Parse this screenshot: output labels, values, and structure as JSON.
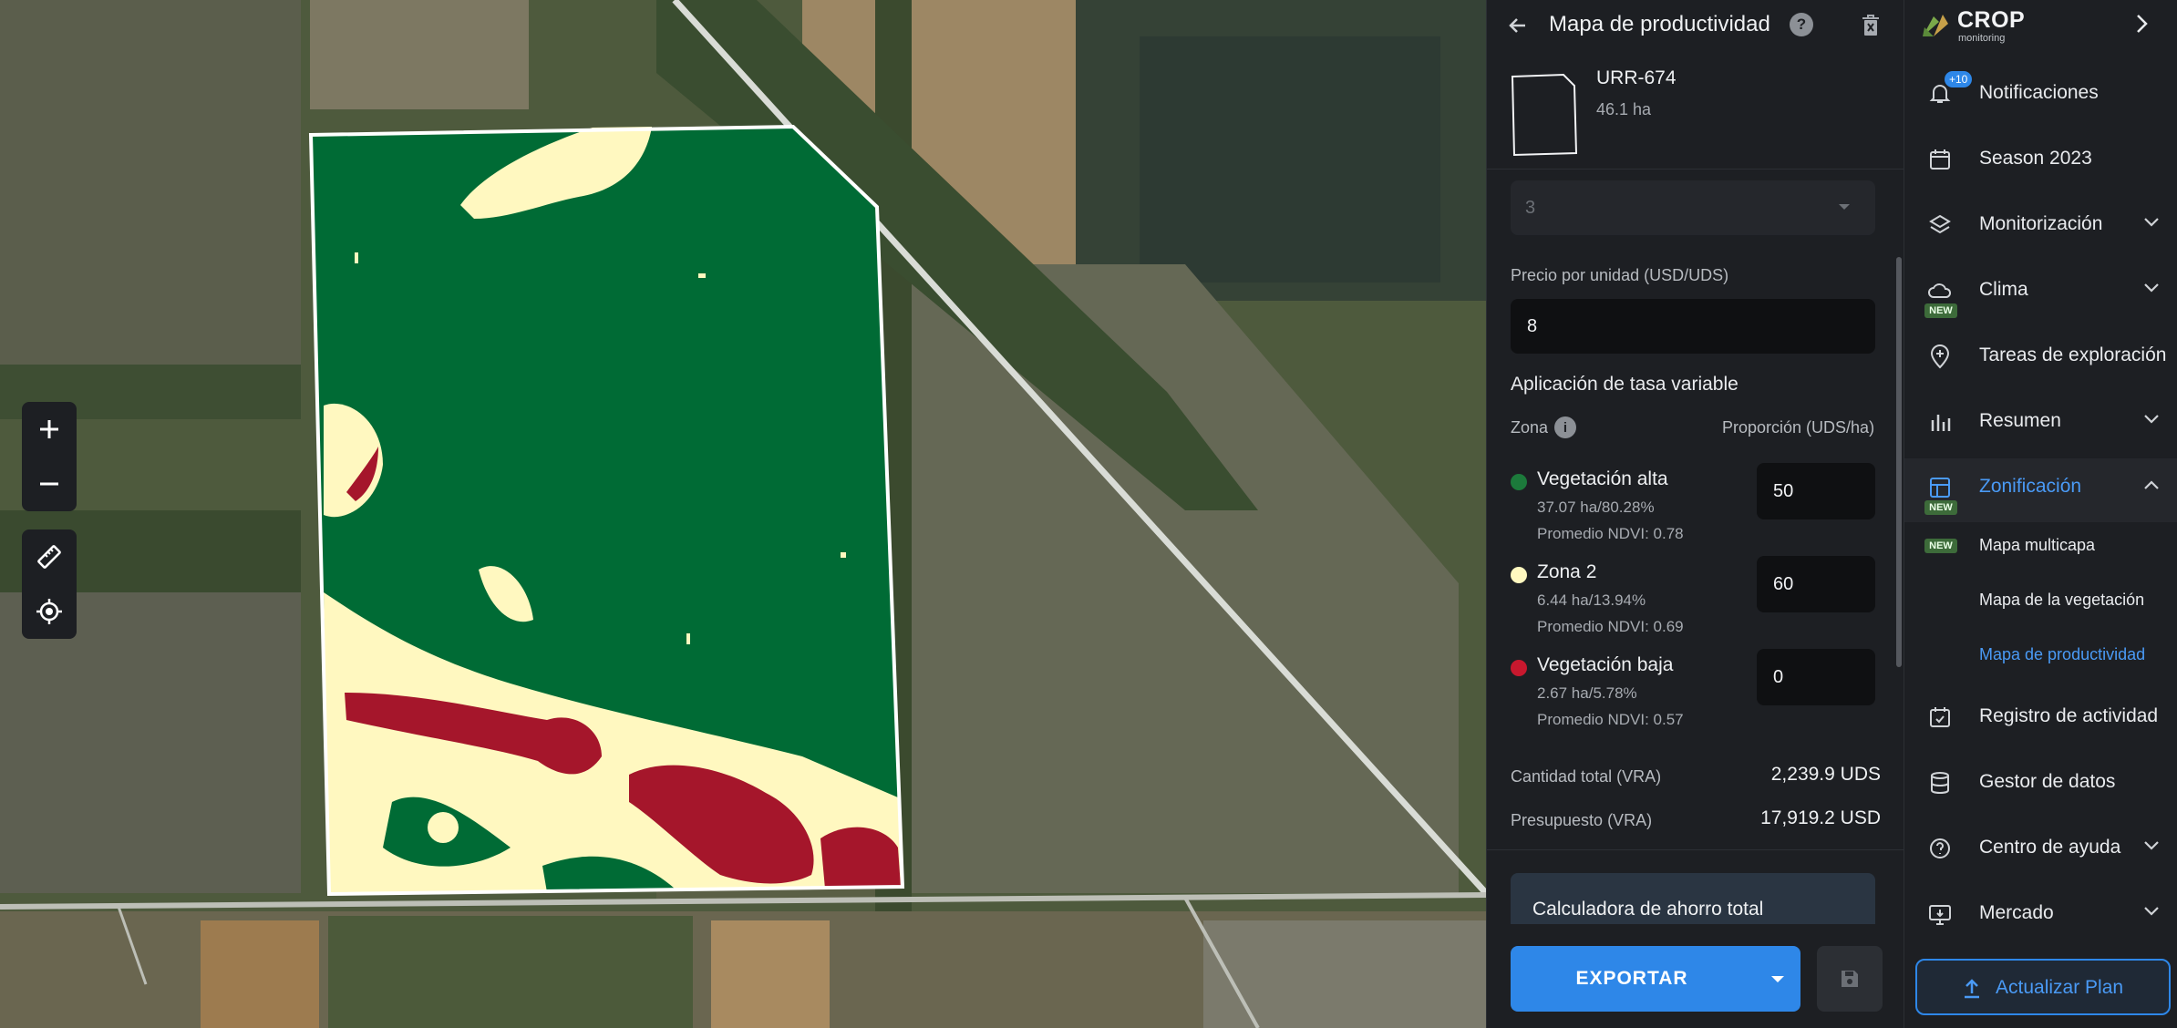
{
  "map": {
    "colors": {
      "high": "#006b35",
      "mid": "#fff8c0",
      "low": "#a5162b",
      "outline": "#ffffff"
    },
    "controls": {
      "zoom_in": "plus-icon",
      "zoom_out": "minus-icon",
      "measure": "ruler-icon",
      "locate": "crosshair-icon"
    }
  },
  "panel": {
    "title": "Mapa de productividad",
    "field": {
      "name": "URR-674",
      "area": "46.1 ha"
    },
    "zones_count": "3",
    "price_label": "Precio por unidad (USD/UDS)",
    "price_value": "8",
    "vra_title": "Aplicación de tasa variable",
    "zone_header": "Zona",
    "rate_header": "Proporción (UDS/ha)",
    "zones": [
      {
        "name": "Vegetación alta",
        "area": "37.07 ha/80.28%",
        "ndvi": "Promedio NDVI: 0.78",
        "rate": "50",
        "color": "#1c7a3b"
      },
      {
        "name": "Zona 2",
        "area": "6.44 ha/13.94%",
        "ndvi": "Promedio NDVI: 0.69",
        "rate": "60",
        "color": "#fff8c0"
      },
      {
        "name": "Vegetación baja",
        "area": "2.67 ha/5.78%",
        "ndvi": "Promedio NDVI: 0.57",
        "rate": "0",
        "color": "#c8182e"
      }
    ],
    "total_label": "Cantidad total (VRA)",
    "total_value": "2,239.9 UDS",
    "budget_label": "Presupuesto (VRA)",
    "budget_value": "17,919.2 USD",
    "calculator_label": "Calculadora de ahorro total",
    "export_label": "EXPORTAR"
  },
  "nav": {
    "brand": "CROP",
    "brand_sub": "monitoring",
    "notif_badge": "+10",
    "new_label": "NEW",
    "items": [
      {
        "label": "Notificaciones"
      },
      {
        "label": "Season 2023"
      },
      {
        "label": "Monitorización"
      },
      {
        "label": "Clima"
      },
      {
        "label": "Tareas de exploración"
      },
      {
        "label": "Resumen"
      },
      {
        "label": "Zonificación"
      },
      {
        "label": "Registro de actividad"
      },
      {
        "label": "Gestor de datos"
      },
      {
        "label": "Centro de ayuda"
      },
      {
        "label": "Mercado"
      }
    ],
    "subitems": [
      {
        "label": "Mapa multicapa"
      },
      {
        "label": "Mapa de la vegetación"
      },
      {
        "label": "Mapa de productividad"
      }
    ],
    "upgrade_label": "Actualizar Plan",
    "accent": "#2e87e8"
  }
}
